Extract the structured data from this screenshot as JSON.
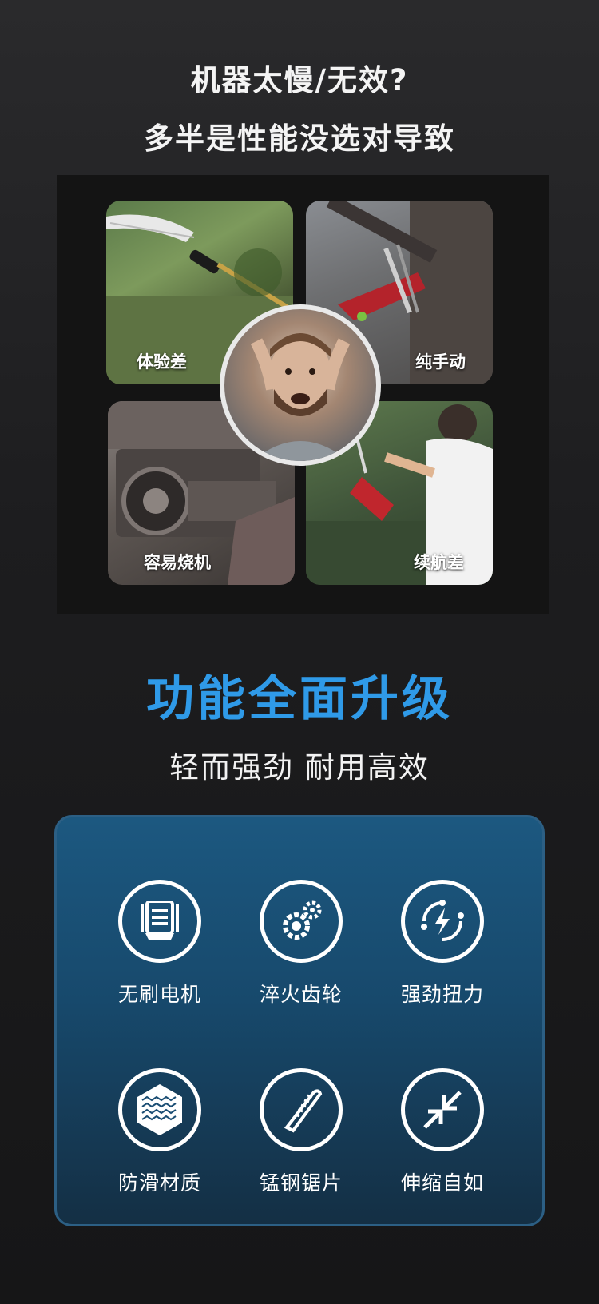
{
  "headline": {
    "line1": "机器太慢/无效?",
    "line2": "多半是性能没选对导致"
  },
  "pain_points": [
    {
      "caption": "体验差",
      "image": "pruning-saw-photo"
    },
    {
      "caption": "纯手动",
      "image": "manual-lopper-photo"
    },
    {
      "caption": "容易烧机",
      "image": "burnt-motor-photo"
    },
    {
      "caption": "续航差",
      "image": "man-with-chainsaw-photo"
    }
  ],
  "center_image": "frustrated-man-photo",
  "section": {
    "title": "功能全面升级",
    "subtitle": "轻而强劲  耐用高效"
  },
  "features": [
    {
      "label": "无刷电机",
      "icon": "brushless-motor-icon"
    },
    {
      "label": "淬火齿轮",
      "icon": "gears-icon"
    },
    {
      "label": "强劲扭力",
      "icon": "lightning-torque-icon"
    },
    {
      "label": "防滑材质",
      "icon": "anti-slip-texture-icon"
    },
    {
      "label": "锰钢锯片",
      "icon": "saw-blade-icon"
    },
    {
      "label": "伸缩自如",
      "icon": "retract-arrows-icon"
    }
  ],
  "colors": {
    "accent": "#2f9ae8",
    "card_top": "#1c5880",
    "card_bottom": "#142f44"
  }
}
